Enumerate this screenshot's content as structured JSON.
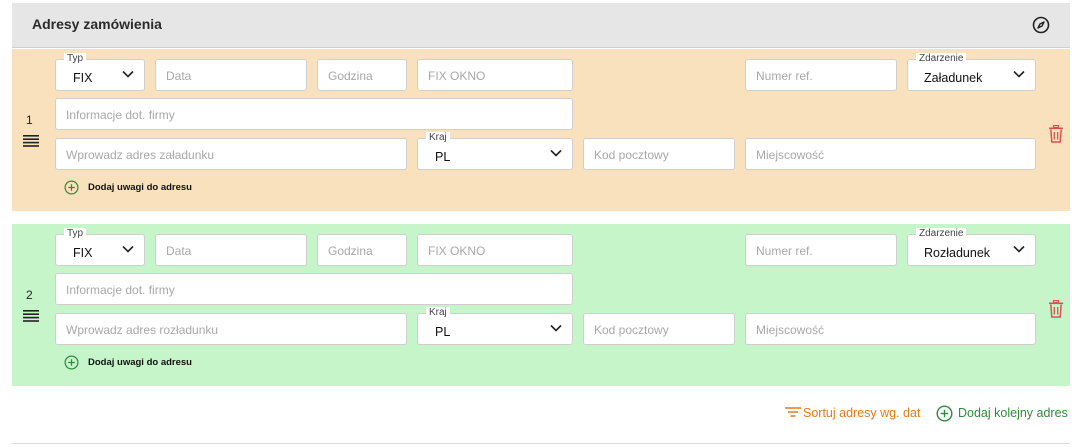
{
  "header": {
    "title": "Adresy zamówienia"
  },
  "blocks": [
    {
      "index": "1",
      "color": "#fae1bd",
      "typ": {
        "label": "Typ",
        "value": "FIX"
      },
      "data_placeholder": "Data",
      "godzina_placeholder": "Godzina",
      "fix_okno_placeholder": "FIX OKNO",
      "numer_ref_placeholder": "Numer ref.",
      "zdarzenie": {
        "label": "Zdarzenie",
        "value": "Załadunek"
      },
      "firma_placeholder": "Informacje dot. firmy",
      "adres_placeholder": "Wprowadz adres załadunku",
      "kraj": {
        "label": "Kraj",
        "value": "PL"
      },
      "kod_placeholder": "Kod pocztowy",
      "miejscowosc_placeholder": "Miejscowość",
      "add_note_label": "Dodaj uwagi do adresu"
    },
    {
      "index": "2",
      "color": "#c6f5c9",
      "typ": {
        "label": "Typ",
        "value": "FIX"
      },
      "data_placeholder": "Data",
      "godzina_placeholder": "Godzina",
      "fix_okno_placeholder": "FIX OKNO",
      "numer_ref_placeholder": "Numer ref.",
      "zdarzenie": {
        "label": "Zdarzenie",
        "value": "Rozładunek"
      },
      "firma_placeholder": "Informacje dot. firmy",
      "adres_placeholder": "Wprowadz adres rozładunku",
      "kraj": {
        "label": "Kraj",
        "value": "PL"
      },
      "kod_placeholder": "Kod pocztowy",
      "miejscowosc_placeholder": "Miejscowość",
      "add_note_label": "Dodaj uwagi do adresu"
    }
  ],
  "footer": {
    "sort_label": "Sortuj adresy wg. dat",
    "add_label": "Dodaj kolejny adres"
  },
  "icons": {
    "header": "compass-icon",
    "row_handle": "drag-handle-icon",
    "row_delete": "trash-icon",
    "add_note": "plus-circle-icon",
    "sort": "sort-icon",
    "add_address": "plus-circle-icon"
  },
  "colors": {
    "accent_orange": "#e07b1a",
    "accent_green": "#2e8b3a",
    "delete_red": "#d9534f"
  }
}
